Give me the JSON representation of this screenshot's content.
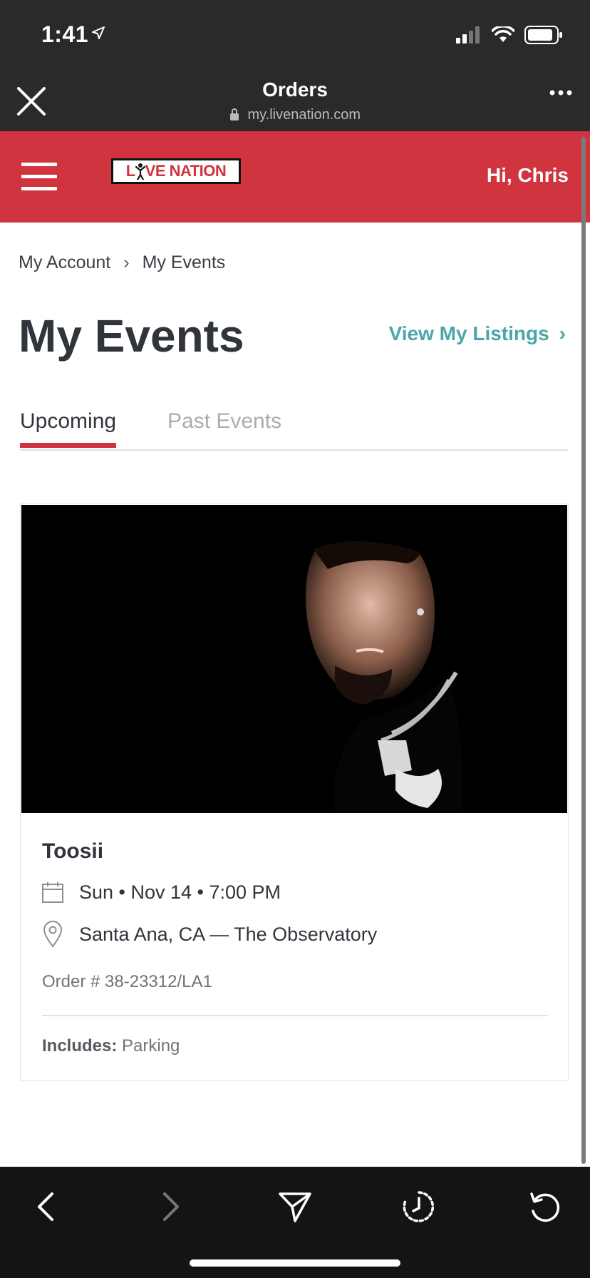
{
  "status_bar": {
    "time": "1:41"
  },
  "browser_nav": {
    "title": "Orders",
    "url": "my.livenation.com"
  },
  "header": {
    "logo_text_a": "L",
    "logo_text_b": "VE NATION",
    "greeting": "Hi, Chris"
  },
  "breadcrumb": {
    "items": [
      "My Account",
      "My Events"
    ],
    "separator": "›"
  },
  "page": {
    "title": "My Events",
    "listings_link": "View My Listings",
    "listings_chevron": "›"
  },
  "tabs": [
    {
      "label": "Upcoming",
      "active": true
    },
    {
      "label": "Past Events",
      "active": false
    }
  ],
  "event": {
    "name": "Toosii",
    "date": "Sun • Nov 14 • 7:00 PM",
    "venue": "Santa Ana, CA — The Observatory",
    "order": "Order # 38-23312/LA1",
    "includes_label": "Includes:",
    "includes_value": "Parking"
  },
  "colors": {
    "brand_red": "#d0343f",
    "link_teal": "#4aa6a9",
    "text_dark": "#2f353b"
  },
  "icons": [
    "close-icon",
    "lock-icon",
    "more-icon",
    "menu-icon",
    "calendar-icon",
    "location-pin-icon",
    "back-icon",
    "forward-icon",
    "share-icon",
    "history-icon",
    "reload-icon"
  ]
}
